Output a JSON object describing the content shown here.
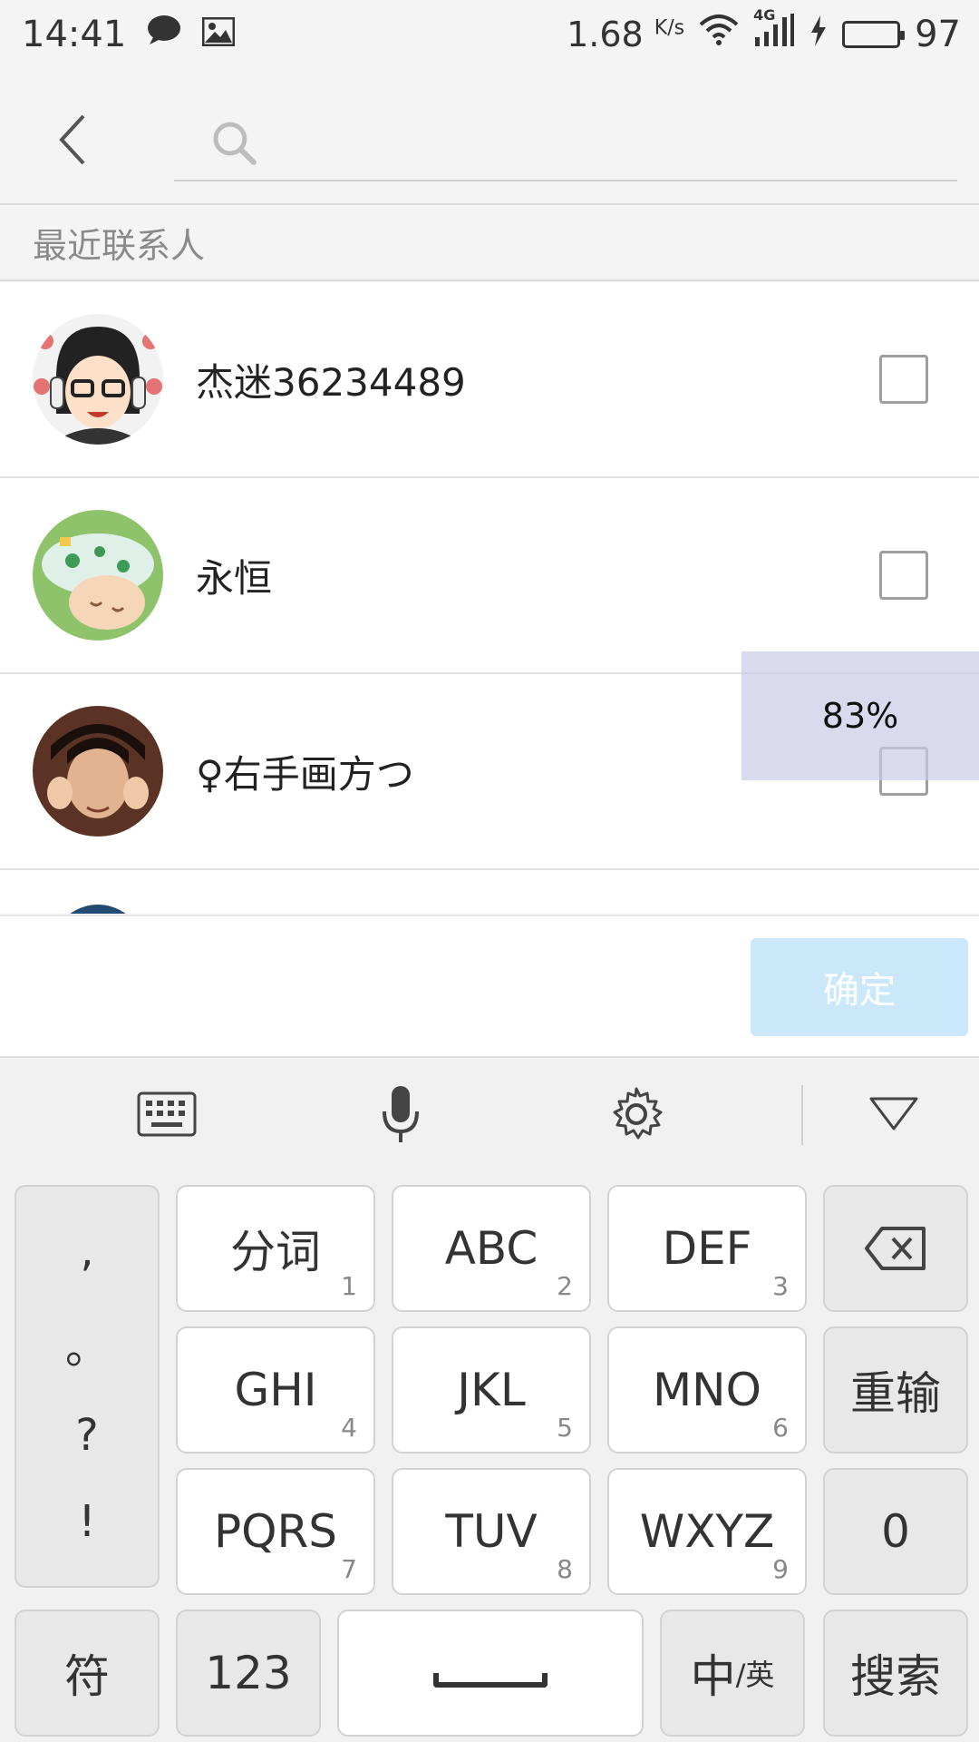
{
  "status_bar": {
    "time": "14:41",
    "speed": "1.68",
    "speed_unit": "K/s",
    "network": "4G",
    "battery": "97",
    "battery_level": 0.97,
    "battery_color": "#3ad13a"
  },
  "search": {
    "placeholder": ""
  },
  "section_title": "最近联系人",
  "contacts": [
    {
      "name": "杰迷36234489",
      "checked": false
    },
    {
      "name": "永恒",
      "checked": false
    },
    {
      "name": "♀右手画方つ",
      "checked": false
    }
  ],
  "overlay_percent": "83%",
  "confirm_label": "确定",
  "keyboard": {
    "punct": [
      ",",
      "。",
      "?",
      "!"
    ],
    "keys": [
      {
        "label": "分词",
        "num": "1"
      },
      {
        "label": "ABC",
        "num": "2"
      },
      {
        "label": "DEF",
        "num": "3"
      },
      {
        "label": "GHI",
        "num": "4"
      },
      {
        "label": "JKL",
        "num": "5"
      },
      {
        "label": "MNO",
        "num": "6"
      },
      {
        "label": "PQRS",
        "num": "7"
      },
      {
        "label": "TUV",
        "num": "8"
      },
      {
        "label": "WXYZ",
        "num": "9"
      }
    ],
    "reinput": "重输",
    "zero": "0",
    "symbols": "符",
    "numbers": "123",
    "zh": "中",
    "en": "/英",
    "search": "搜索"
  },
  "colors": {
    "accent_light": "#cbe8fb",
    "background": "#f4f4f4"
  }
}
